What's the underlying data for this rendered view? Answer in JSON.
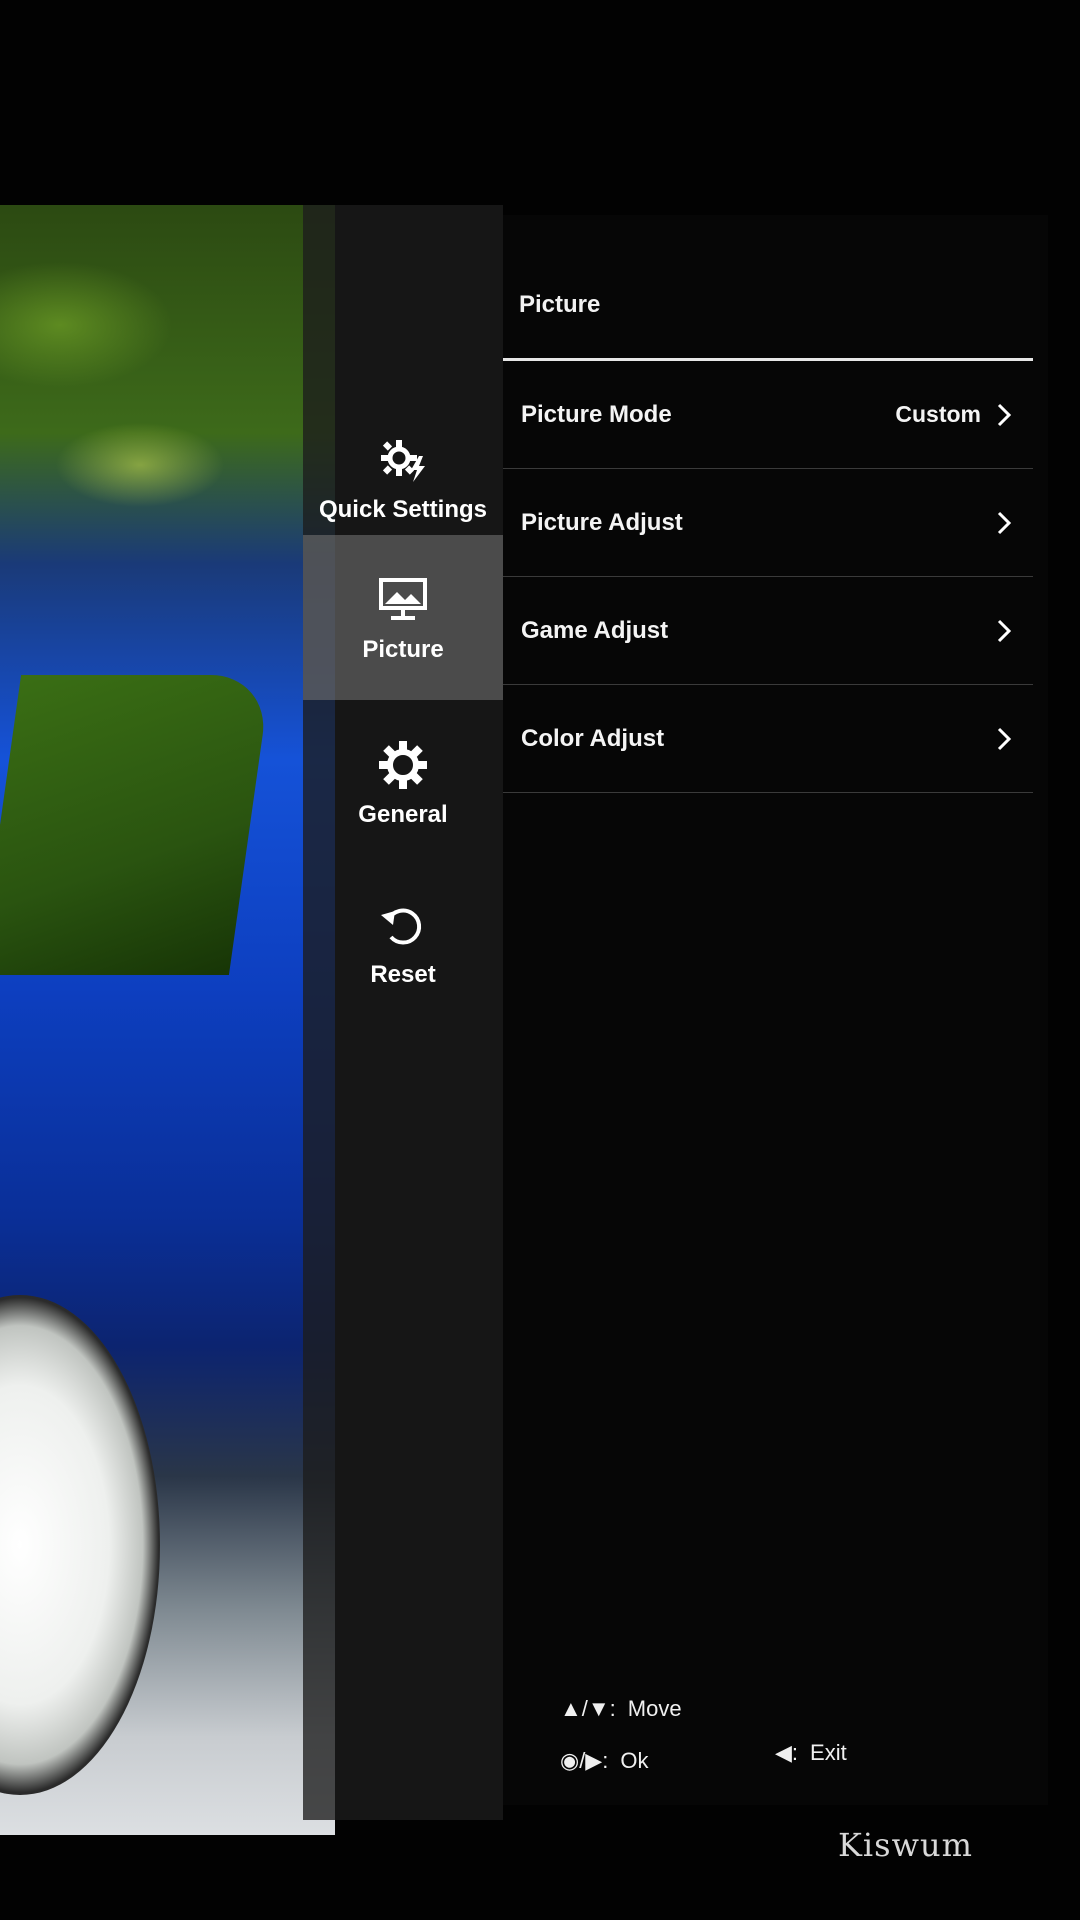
{
  "nav": {
    "items": [
      {
        "label": "Quick Settings",
        "icon": "quick-settings-icon",
        "active": false
      },
      {
        "label": "Picture",
        "icon": "picture-icon",
        "active": true
      },
      {
        "label": "General",
        "icon": "gear-icon",
        "active": false
      },
      {
        "label": "Reset",
        "icon": "reset-icon",
        "active": false
      }
    ]
  },
  "menu": {
    "title": "Picture",
    "rows": [
      {
        "label": "Picture Mode",
        "value": "Custom"
      },
      {
        "label": "Picture Adjust",
        "value": ""
      },
      {
        "label": "Game Adjust",
        "value": ""
      },
      {
        "label": "Color Adjust",
        "value": ""
      }
    ]
  },
  "footer": {
    "move_label": "Move",
    "ok_label": "Ok",
    "exit_label": "Exit",
    "move_keys": "▲/▼:",
    "ok_keys": "◉/▶:",
    "exit_keys": "◀:"
  },
  "watermark": "Kiswum",
  "colors": {
    "panel_bg": "#060606",
    "nav_bg": "#1c1c1c",
    "active_bg": "#787878",
    "text": "#ffffff",
    "divider": "#3a3a3a"
  }
}
